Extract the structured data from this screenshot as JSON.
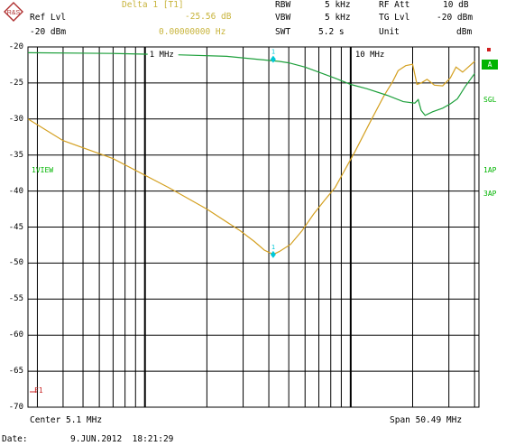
{
  "header": {
    "logo_text": "R&S",
    "marker_label": "Delta 1 [T1]",
    "marker_value": "-25.56 dB",
    "marker_freq": "0.00000000 Hz",
    "ref_lvl_label": "Ref Lvl",
    "ref_lvl_value": "-20 dBm",
    "rbw_label": "RBW",
    "rbw_value": "5 kHz",
    "vbw_label": "VBW",
    "vbw_value": "5 kHz",
    "swt_label": "SWT",
    "swt_value": "5.2 s",
    "rf_att_label": "RF Att",
    "rf_att_value": "10 dB",
    "tg_lvl_label": "TG Lvl",
    "tg_lvl_value": "-20 dBm",
    "unit_label": "Unit",
    "unit_value": "dBm"
  },
  "side_labels": {
    "left_1view": "1VIEW",
    "right_a": "A",
    "right_sgl": "SGL",
    "right_1ap": "1AP",
    "right_3ap": "3AP",
    "left_f1": "F1"
  },
  "footer": {
    "center": "Center 5.1 MHz",
    "span": "Span 50.49 MHz",
    "date_label": "Date:",
    "date_value": "9.JUN.2012  18:21:29"
  },
  "colors": {
    "trace_yellow": "#d4a020",
    "trace_green": "#1ea03c",
    "marker_cyan": "#00c8d8",
    "label_green": "#00b400",
    "marker_label_yellow": "#c8b43c"
  },
  "chart_data": {
    "type": "line",
    "x_scale": "log",
    "x_tick_labels": [
      {
        "x": 1,
        "label": "1 MHz"
      },
      {
        "x": 10,
        "label": "10 MHz"
      }
    ],
    "y_ticks": [
      -20,
      -25,
      -30,
      -35,
      -40,
      -45,
      -50,
      -55,
      -60,
      -65,
      -70
    ],
    "ylim": [
      -70,
      -20
    ],
    "grid": true,
    "series": [
      {
        "color": "yellow",
        "points": [
          [
            0.27,
            -30.0
          ],
          [
            0.4,
            -33.0
          ],
          [
            0.7,
            -35.5
          ],
          [
            1.3,
            -39.5
          ],
          [
            2.0,
            -42.5
          ],
          [
            2.9,
            -45.5
          ],
          [
            3.4,
            -47.0
          ],
          [
            3.8,
            -48.2
          ],
          [
            4.2,
            -48.8
          ],
          [
            4.5,
            -48.4
          ],
          [
            5.1,
            -47.4
          ],
          [
            5.8,
            -45.5
          ],
          [
            6.6,
            -43.2
          ],
          [
            7.5,
            -41.2
          ],
          [
            8.4,
            -39.5
          ],
          [
            10.5,
            -34.5
          ],
          [
            12.5,
            -30.3
          ],
          [
            14.5,
            -26.8
          ],
          [
            16.0,
            -24.8
          ],
          [
            17.0,
            -23.3
          ],
          [
            18.5,
            -22.6
          ],
          [
            20.0,
            -22.4
          ],
          [
            21.0,
            -25.2
          ],
          [
            22.0,
            -25.0
          ],
          [
            23.5,
            -24.5
          ],
          [
            25.5,
            -25.3
          ],
          [
            28.0,
            -25.4
          ],
          [
            30.5,
            -24.3
          ],
          [
            32.5,
            -22.8
          ],
          [
            35.0,
            -23.5
          ],
          [
            40.0,
            -22.0
          ]
        ]
      },
      {
        "color": "green",
        "points": [
          [
            0.27,
            -20.8
          ],
          [
            0.7,
            -20.9
          ],
          [
            1.0,
            -21.0
          ],
          [
            1.5,
            -21.1
          ],
          [
            2.5,
            -21.3
          ],
          [
            3.5,
            -21.7
          ],
          [
            4.5,
            -22.0
          ],
          [
            5.0,
            -22.2
          ],
          [
            6.0,
            -22.8
          ],
          [
            7.0,
            -23.5
          ],
          [
            8.5,
            -24.4
          ],
          [
            10.0,
            -25.2
          ],
          [
            12.0,
            -25.8
          ],
          [
            15.0,
            -26.7
          ],
          [
            18.0,
            -27.6
          ],
          [
            20.5,
            -27.8
          ],
          [
            21.3,
            -27.3
          ],
          [
            22.0,
            -28.8
          ],
          [
            23.0,
            -29.5
          ],
          [
            25.0,
            -29.0
          ],
          [
            28.0,
            -28.5
          ],
          [
            30.5,
            -27.9
          ],
          [
            33.0,
            -27.2
          ],
          [
            36.0,
            -25.5
          ],
          [
            40.0,
            -23.7
          ]
        ]
      }
    ],
    "markers": [
      {
        "label": "1",
        "x": 4.2,
        "y": -48.8,
        "series": "yellow"
      },
      {
        "label": "1",
        "x": 4.2,
        "y": -21.7,
        "series": "green"
      }
    ]
  }
}
